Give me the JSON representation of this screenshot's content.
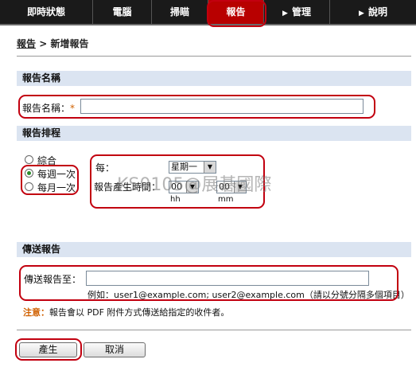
{
  "nav": {
    "tabs": [
      {
        "label": "即時狀態"
      },
      {
        "label": "電腦"
      },
      {
        "label": "掃瞄"
      },
      {
        "label": "報告"
      },
      {
        "label": "管理"
      },
      {
        "label": "說明"
      }
    ],
    "active_color": "#b80000"
  },
  "breadcrumb": {
    "parent": "報告",
    "separator": ">",
    "current": "新增報告"
  },
  "section_name": {
    "header": "報告名稱",
    "field_label": "報告名稱：",
    "required_mark": "*",
    "value": ""
  },
  "section_schedule": {
    "header": "報告排程",
    "options": [
      {
        "label": "綜合",
        "selected": false
      },
      {
        "label": "每週一次",
        "selected": true
      },
      {
        "label": "每月一次",
        "selected": false
      }
    ],
    "every_label": "每：",
    "day_value": "星期一",
    "time_label": "報告產生時間：",
    "hour_value": "00",
    "minute_value": "00",
    "hour_unit": "hh",
    "minute_unit": "mm"
  },
  "section_send": {
    "header": "傳送報告",
    "field_label": "傳送報告至：",
    "value": "",
    "example": "例如：user1@example.com; user2@example.com（請以分號分隔多個項目）",
    "note_label": "注意：",
    "note_text": "報告會以 PDF 附件方式傳送給指定的收件者。"
  },
  "buttons": {
    "create": "產生",
    "cancel": "取消"
  },
  "watermark": "KS0105@展碁國際",
  "highlight_color": "#c2000f"
}
